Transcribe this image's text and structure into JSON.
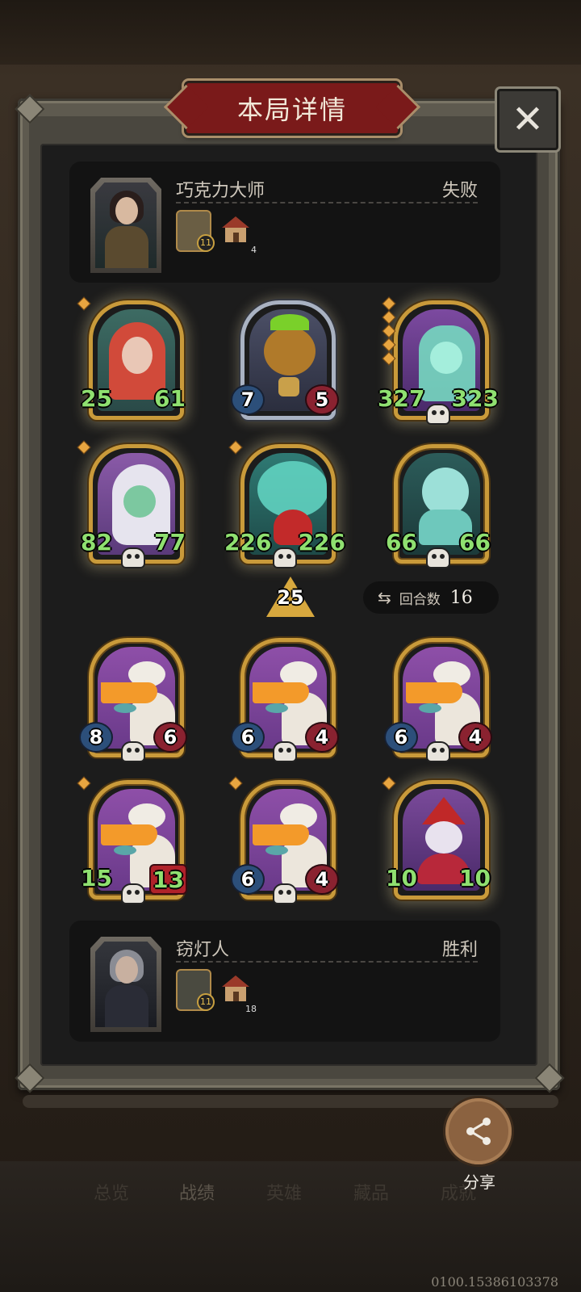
{
  "header": {
    "title": "本局详情"
  },
  "players": {
    "top": {
      "name": "巧克力大师",
      "result": "失败",
      "tier_badge": "11",
      "house_count": "4"
    },
    "bottom": {
      "name": "窃灯人",
      "result": "胜利",
      "tier_badge": "11",
      "house_count": "18"
    }
  },
  "enemy_units": [
    {
      "atk": "25",
      "hp": "61"
    },
    {
      "atk": "7",
      "hp": "5"
    },
    {
      "atk": "327",
      "hp": "323"
    },
    {
      "atk": "82",
      "hp": "77"
    },
    {
      "atk": "226",
      "hp": "226"
    },
    {
      "atk": "66",
      "hp": "66"
    }
  ],
  "level_arrow": "25",
  "turn": {
    "label": "回合数",
    "value": "16"
  },
  "player_units": [
    {
      "atk": "8",
      "hp": "6"
    },
    {
      "atk": "6",
      "hp": "4"
    },
    {
      "atk": "6",
      "hp": "4"
    },
    {
      "atk": "15",
      "hp": "13"
    },
    {
      "atk": "6",
      "hp": "4"
    },
    {
      "atk": "10",
      "hp": "10"
    }
  ],
  "share": {
    "label": "分享"
  },
  "nav": {
    "tabs": [
      "总览",
      "战绩",
      "英雄",
      "藏品",
      "成就"
    ]
  },
  "footer": {
    "id": "0100.15386103378"
  }
}
